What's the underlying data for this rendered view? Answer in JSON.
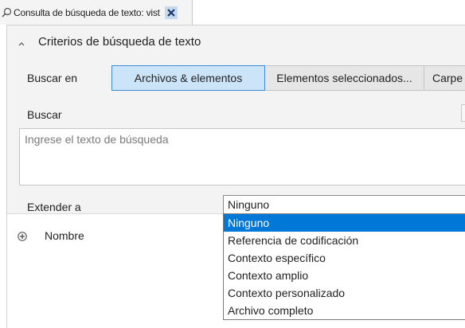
{
  "tab": {
    "title": "Consulta de búsqueda de texto: vist",
    "icon": "search-icon",
    "close_icon": "close-icon"
  },
  "criteria": {
    "section_title": "Criterios de búsqueda de texto",
    "search_in_label": "Buscar en",
    "scope_buttons": [
      "Archivos & elementos",
      "Elementos seleccionados...",
      "Carpe"
    ],
    "search_label": "Buscar",
    "search_placeholder": "Ingrese el texto de búsqueda",
    "extend_label": "Extender a",
    "extend_value": "Ninguno",
    "extend_options": [
      "Ninguno",
      "Referencia de codificación",
      "Contexto específico",
      "Contexto amplio",
      "Contexto personalizado",
      "Archivo completo"
    ],
    "selected_option": "Ninguno"
  },
  "tree": {
    "name_label": "Nombre"
  },
  "colors": {
    "accent": "#0078d7",
    "active_button_bg": "#cce4f7",
    "active_button_border": "#3c8ad6",
    "panel_bg": "#f3f3f3"
  }
}
